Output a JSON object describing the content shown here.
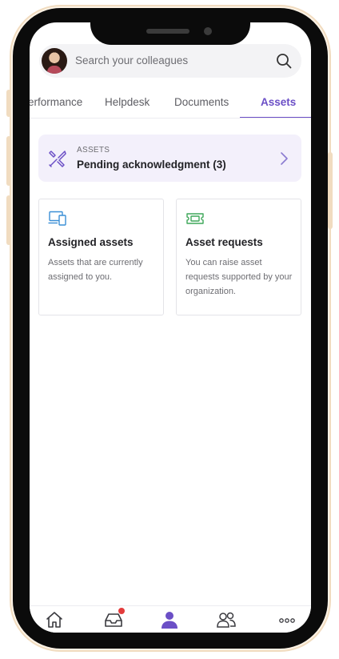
{
  "search": {
    "placeholder": "Search your colleagues"
  },
  "tabs": [
    {
      "label": "erformance"
    },
    {
      "label": "Helpdesk"
    },
    {
      "label": "Documents"
    },
    {
      "label": "Assets"
    }
  ],
  "pending": {
    "eyebrow": "ASSETS",
    "title": "Pending acknowledgment (3)"
  },
  "cards": [
    {
      "title": "Assigned assets",
      "description": "Assets that are currently assigned to you."
    },
    {
      "title": "Asset requests",
      "description": "You can raise asset requests supported by your organization."
    }
  ],
  "bottom_nav": {
    "items": [
      {
        "icon": "home-icon"
      },
      {
        "icon": "inbox-icon",
        "badge": true
      },
      {
        "icon": "person-icon",
        "active": true
      },
      {
        "icon": "people-icon"
      },
      {
        "icon": "more-icon"
      }
    ]
  },
  "colors": {
    "accent": "#6b4fc6",
    "badge": "#e33b3b",
    "asset_icon_blue": "#3a8fd6",
    "asset_icon_green": "#3fa75a"
  }
}
